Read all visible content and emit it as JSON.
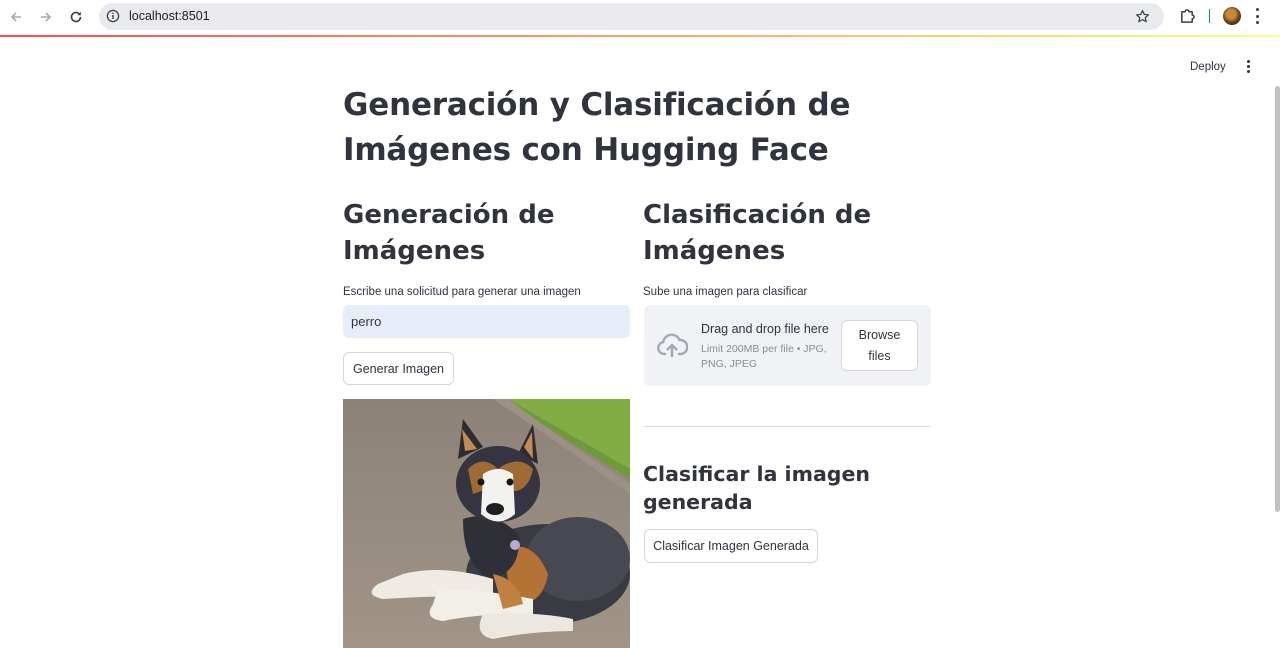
{
  "browser": {
    "url": "localhost:8501"
  },
  "header": {
    "deploy_label": "Deploy"
  },
  "page": {
    "title": "Generación y Clasificación de Imágenes con Hugging Face"
  },
  "generation": {
    "heading": "Generación de Imágenes",
    "prompt_label": "Escribe una solicitud para generar una imagen",
    "prompt_value": "perro",
    "generate_button": "Generar Imagen"
  },
  "classification": {
    "heading": "Clasificación de Imágenes",
    "upload_label": "Sube una imagen para clasificar",
    "dropzone_title": "Drag and drop file here",
    "dropzone_limit": "Limit 200MB per file • JPG, PNG, JPEG",
    "browse_button": "Browse files",
    "generated_heading": "Clasificar la imagen generada",
    "classify_button": "Clasificar Imagen Generada"
  },
  "colors": {
    "accent_gradient_start": "#ff4b4b",
    "accent_gradient_end": "#fffd80",
    "text": "#31333f",
    "input_bg": "#e8eef9",
    "dropzone_bg": "#f0f2f6"
  },
  "icons": [
    "back-arrow-icon",
    "forward-arrow-icon",
    "reload-icon",
    "info-icon",
    "star-icon",
    "extensions-icon",
    "more-vert-icon",
    "cloud-upload-icon"
  ]
}
